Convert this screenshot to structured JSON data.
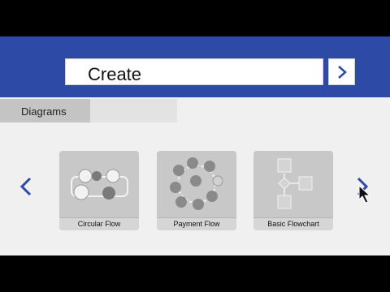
{
  "header": {
    "title": "Create"
  },
  "tabs": [
    {
      "label": "Diagrams"
    }
  ],
  "templates": [
    {
      "label": "Circular Flow"
    },
    {
      "label": "Payment Flow"
    },
    {
      "label": "Basic Flowchart"
    }
  ],
  "colors": {
    "accent": "#2c4aa6",
    "background": "#f0f0f0",
    "card": "#c8c8c8",
    "arrow": "#2c4aa6"
  }
}
